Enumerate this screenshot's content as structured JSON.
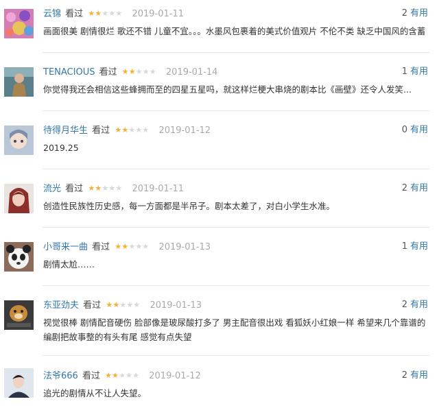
{
  "colors": {
    "link": "#3377aa",
    "star_on": "#f6b034",
    "star_off": "#d8d8d8",
    "date": "#aaaaaa"
  },
  "comments": [
    {
      "user": "云锦",
      "status": "看过",
      "rating": 2,
      "date": "2019-01-11",
      "votes": "2",
      "useful_label": "有用",
      "text": "画面很美 剧情很烂 歌还不错 儿童不宜。。。水墨风包裹着的美式价值观片 不伦不类 缺乏中国风的含蓄"
    },
    {
      "user": "TENACIOUS",
      "status": "看过",
      "rating": 2,
      "date": "2019-01-14",
      "votes": "1",
      "useful_label": "有用",
      "text": "你觉得我还会相信这些蜂拥而至的四星五星吗，就这样烂梗大串烧的剧本比《画壁》还令人发笑..."
    },
    {
      "user": "待得月华生",
      "status": "看过",
      "rating": 2,
      "date": "2019-01-12",
      "votes": "0",
      "useful_label": "有用",
      "text": "2019.25"
    },
    {
      "user": "流光",
      "status": "看过",
      "rating": 2,
      "date": "2019-01-11",
      "votes": "2",
      "useful_label": "有用",
      "text": "创造性民族性历史感，每一方面都是半吊子。剧本太差了，对白小学生水准。"
    },
    {
      "user": "小哥来一曲",
      "status": "看过",
      "rating": 2,
      "date": "2019-01-13",
      "votes": "1",
      "useful_label": "有用",
      "text": "剧情太尬……"
    },
    {
      "user": "东亚劲夫",
      "status": "看过",
      "rating": 2,
      "date": "2019-01-13",
      "votes": "2",
      "useful_label": "有用",
      "text": "视觉很棒 剧情配音硬伤 脸部像是玻尿酸打多了 男主配音很出戏 看狐妖小红娘一样 希望来几个靠谱的编剧把故事整的有头有尾 感觉有点失望"
    },
    {
      "user": "法爷666",
      "status": "看过",
      "rating": 2,
      "date": "2019-01-12",
      "votes": "2",
      "useful_label": "有用",
      "text": "追光的剧情从不让人失望。"
    }
  ]
}
